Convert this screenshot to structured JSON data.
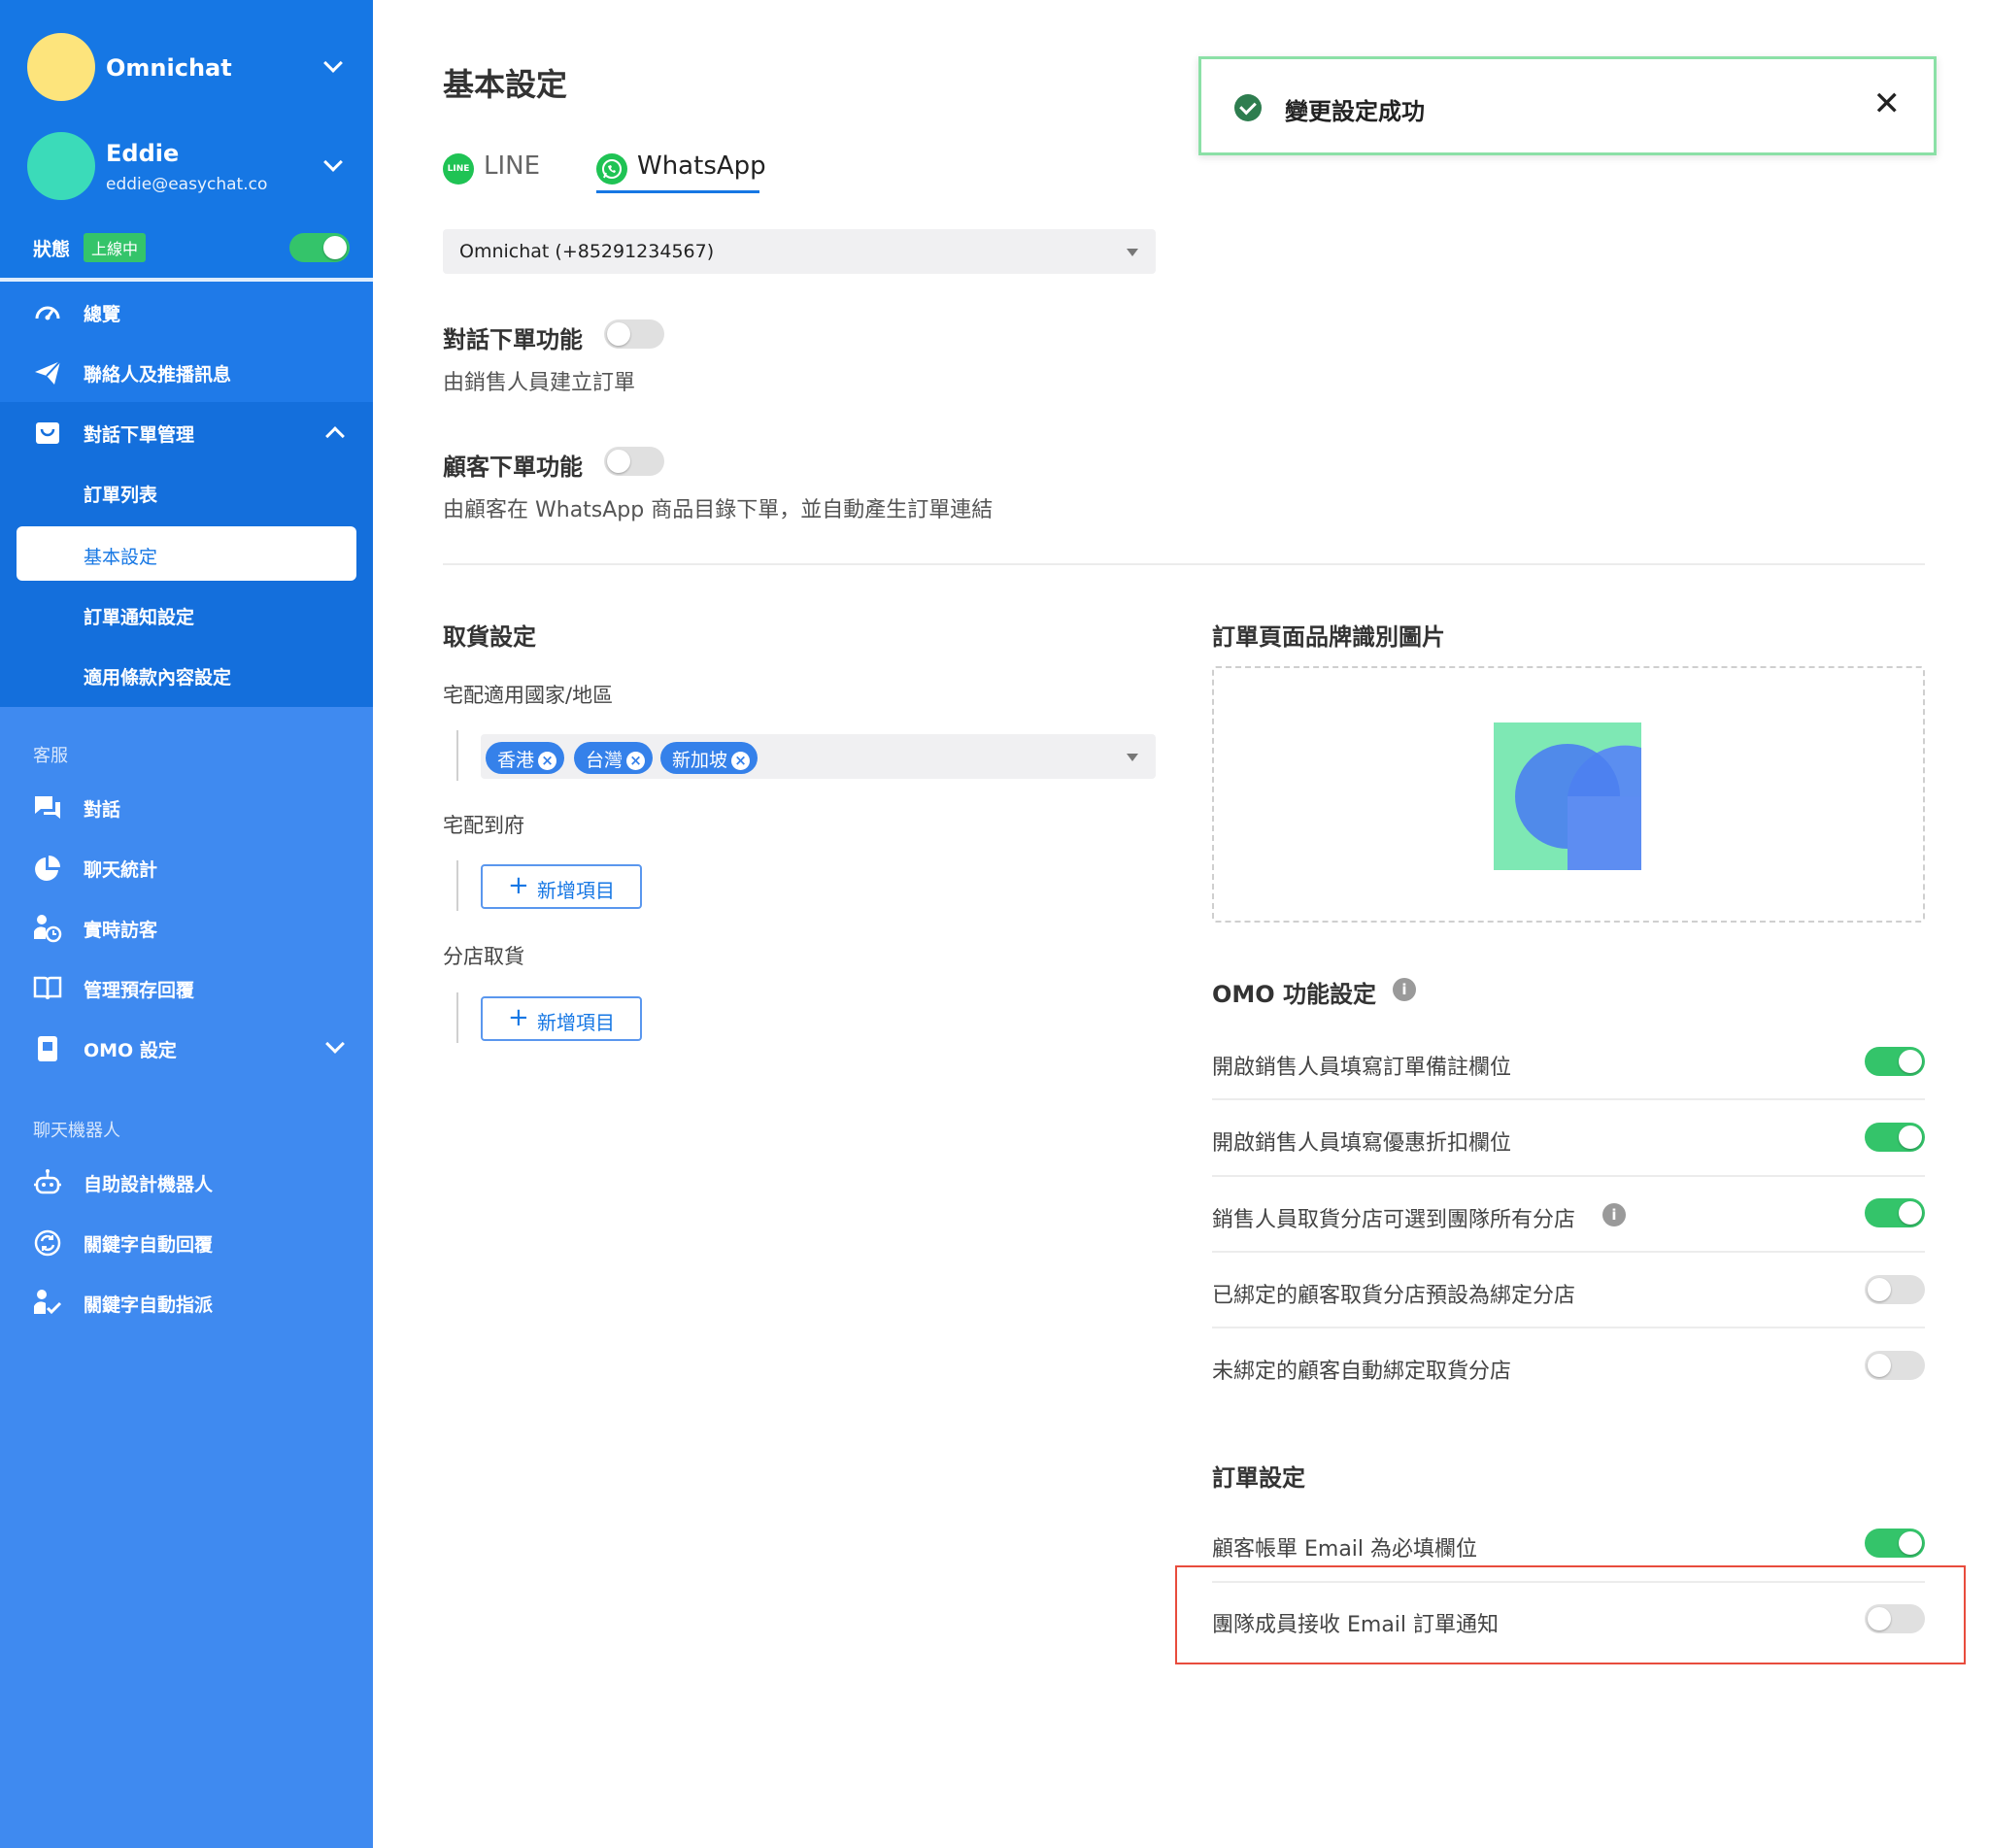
{
  "sidebar": {
    "org": {
      "name": "Omnichat",
      "avatar_color": "#fde47c"
    },
    "user": {
      "name": "Eddie",
      "email": "eddie@easychat.co",
      "avatar_color": "#3bdbb9"
    },
    "status": {
      "label": "狀態",
      "badge": "上線中",
      "online": true
    },
    "nav": [
      {
        "label": "總覽",
        "icon": "dashboard-icon"
      },
      {
        "label": "聯絡人及推播訊息",
        "icon": "paper-plane-icon"
      },
      {
        "label": "對話下單管理",
        "icon": "shopping-bag-icon",
        "expanded": true
      }
    ],
    "order_sub": [
      {
        "label": "訂單列表"
      },
      {
        "label": "基本設定",
        "active": true
      },
      {
        "label": "訂單通知設定"
      },
      {
        "label": "適用條款內容設定"
      }
    ],
    "support_section": "客服",
    "support_nav": [
      {
        "label": "對話",
        "icon": "chat-bubbles-icon"
      },
      {
        "label": "聊天統計",
        "icon": "pie-chart-icon"
      },
      {
        "label": "實時訪客",
        "icon": "visitor-clock-icon"
      },
      {
        "label": "管理預存回覆",
        "icon": "book-icon"
      },
      {
        "label": "OMO 設定",
        "icon": "store-badge-icon"
      }
    ],
    "bot_section": "聊天機器人",
    "bot_nav": [
      {
        "label": "自助設計機器人",
        "icon": "robot-icon"
      },
      {
        "label": "關鍵字自動回覆",
        "icon": "auto-reply-icon"
      },
      {
        "label": "關鍵字自動指派",
        "icon": "assign-user-icon"
      }
    ]
  },
  "main": {
    "title": "基本設定",
    "tabs": [
      {
        "label": "LINE",
        "icon": "line-icon",
        "icon_text": "LINE"
      },
      {
        "label": "WhatsApp",
        "icon": "whatsapp-icon",
        "active": true
      }
    ],
    "account_select": "Omnichat (+85291234567)",
    "chat_order": {
      "title": "對話下單功能",
      "desc": "由銷售人員建立訂單",
      "enabled": false
    },
    "customer_order": {
      "title": "顧客下單功能",
      "desc": "由顧客在 WhatsApp 商品目錄下單，並自動產生訂單連結",
      "enabled": false
    },
    "pickup": {
      "title": "取貨設定",
      "delivery_regions_label": "宅配適用國家/地區",
      "regions": [
        "香港",
        "台灣",
        "新加坡"
      ],
      "home_delivery_label": "宅配到府",
      "store_pickup_label": "分店取貨",
      "add_item_label": "新增項目"
    },
    "brand_image": {
      "title": "訂單頁面品牌識別圖片"
    },
    "omo": {
      "title": "OMO 功能設定",
      "rows": [
        {
          "label": "開啟銷售人員填寫訂單備註欄位",
          "on": true
        },
        {
          "label": "開啟銷售人員填寫優惠折扣欄位",
          "on": true
        },
        {
          "label": "銷售人員取貨分店可選到團隊所有分店",
          "on": true,
          "info": true
        },
        {
          "label": "已綁定的顧客取貨分店預設為綁定分店",
          "on": false
        },
        {
          "label": "未綁定的顧客自動綁定取貨分店",
          "on": false
        }
      ]
    },
    "order_settings": {
      "title": "訂單設定",
      "rows": [
        {
          "label": "顧客帳單 Email 為必填欄位",
          "on": true
        },
        {
          "label": "團隊成員接收 Email 訂單通知",
          "on": false
        }
      ]
    }
  },
  "toast": {
    "message": "變更設定成功",
    "close": "✕"
  },
  "colors": {
    "sidebar": "#3f8af0",
    "accent": "#1677e4",
    "toggle_on": "#34c46a",
    "highlight": "#e84c3d"
  }
}
